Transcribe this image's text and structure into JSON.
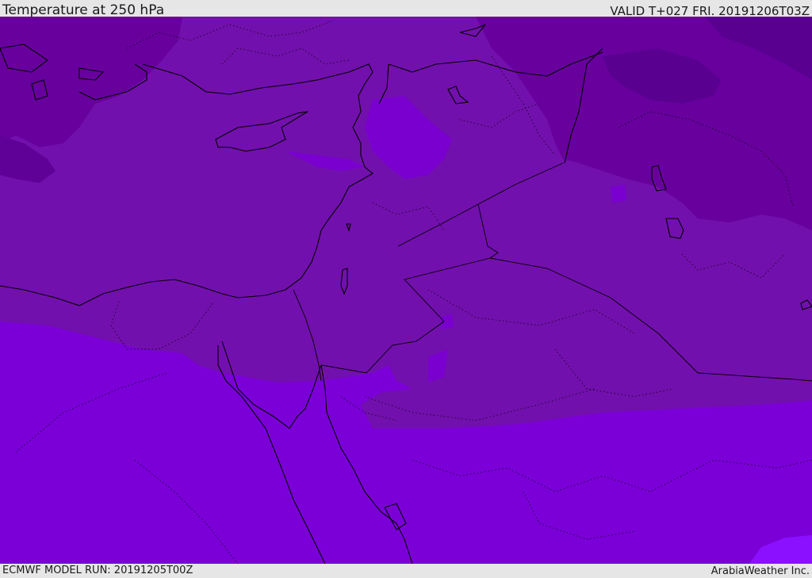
{
  "header": {
    "title": "Temperature at 250 hPa",
    "valid": "VALID T+027 FRI. 20191206T03Z"
  },
  "footer": {
    "model_run": "ECMWF MODEL RUN: 20191205T00Z",
    "credit": "ArabiaWeather Inc."
  },
  "map": {
    "colors": {
      "band_darkest": "#5a0090",
      "band_dark": "#68009e",
      "band_mid": "#7210ad",
      "band_light": "#7b00d8",
      "band_brightest": "#8a10ff",
      "coastline": "#000000",
      "borders": "#1a0030"
    }
  }
}
